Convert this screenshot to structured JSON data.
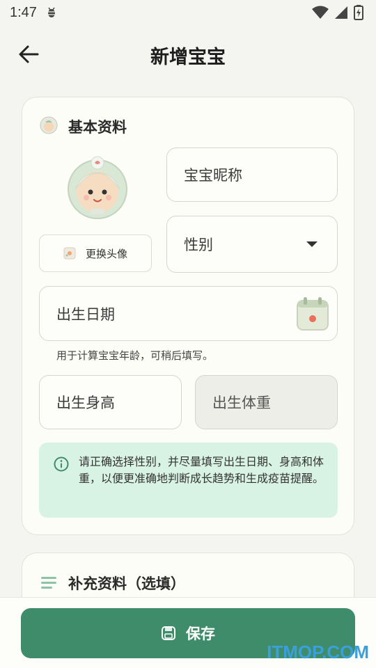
{
  "status_bar": {
    "time": "1:47"
  },
  "header": {
    "title": "新增宝宝"
  },
  "basic_card": {
    "title": "基本资料",
    "change_avatar_label": "更换头像",
    "nickname_placeholder": "宝宝昵称",
    "gender_placeholder": "性别",
    "birthdate_placeholder": "出生日期",
    "birthdate_hint": "用于计算宝宝年龄，可稍后填写。",
    "height_placeholder": "出生身高",
    "weight_placeholder": "出生体重",
    "info_text": "请正确选择性别，并尽量填写出生日期、身高和体重，以便更准确地判断成长趋势和生成疫苗提醒。"
  },
  "extra_card": {
    "title": "补充资料（选填）"
  },
  "footer": {
    "save_label": "保存"
  },
  "watermark": "ITMOP.COM",
  "colors": {
    "accent": "#3f8c6b",
    "info_bg": "#d8f3e4",
    "background": "#f4f4f0"
  }
}
